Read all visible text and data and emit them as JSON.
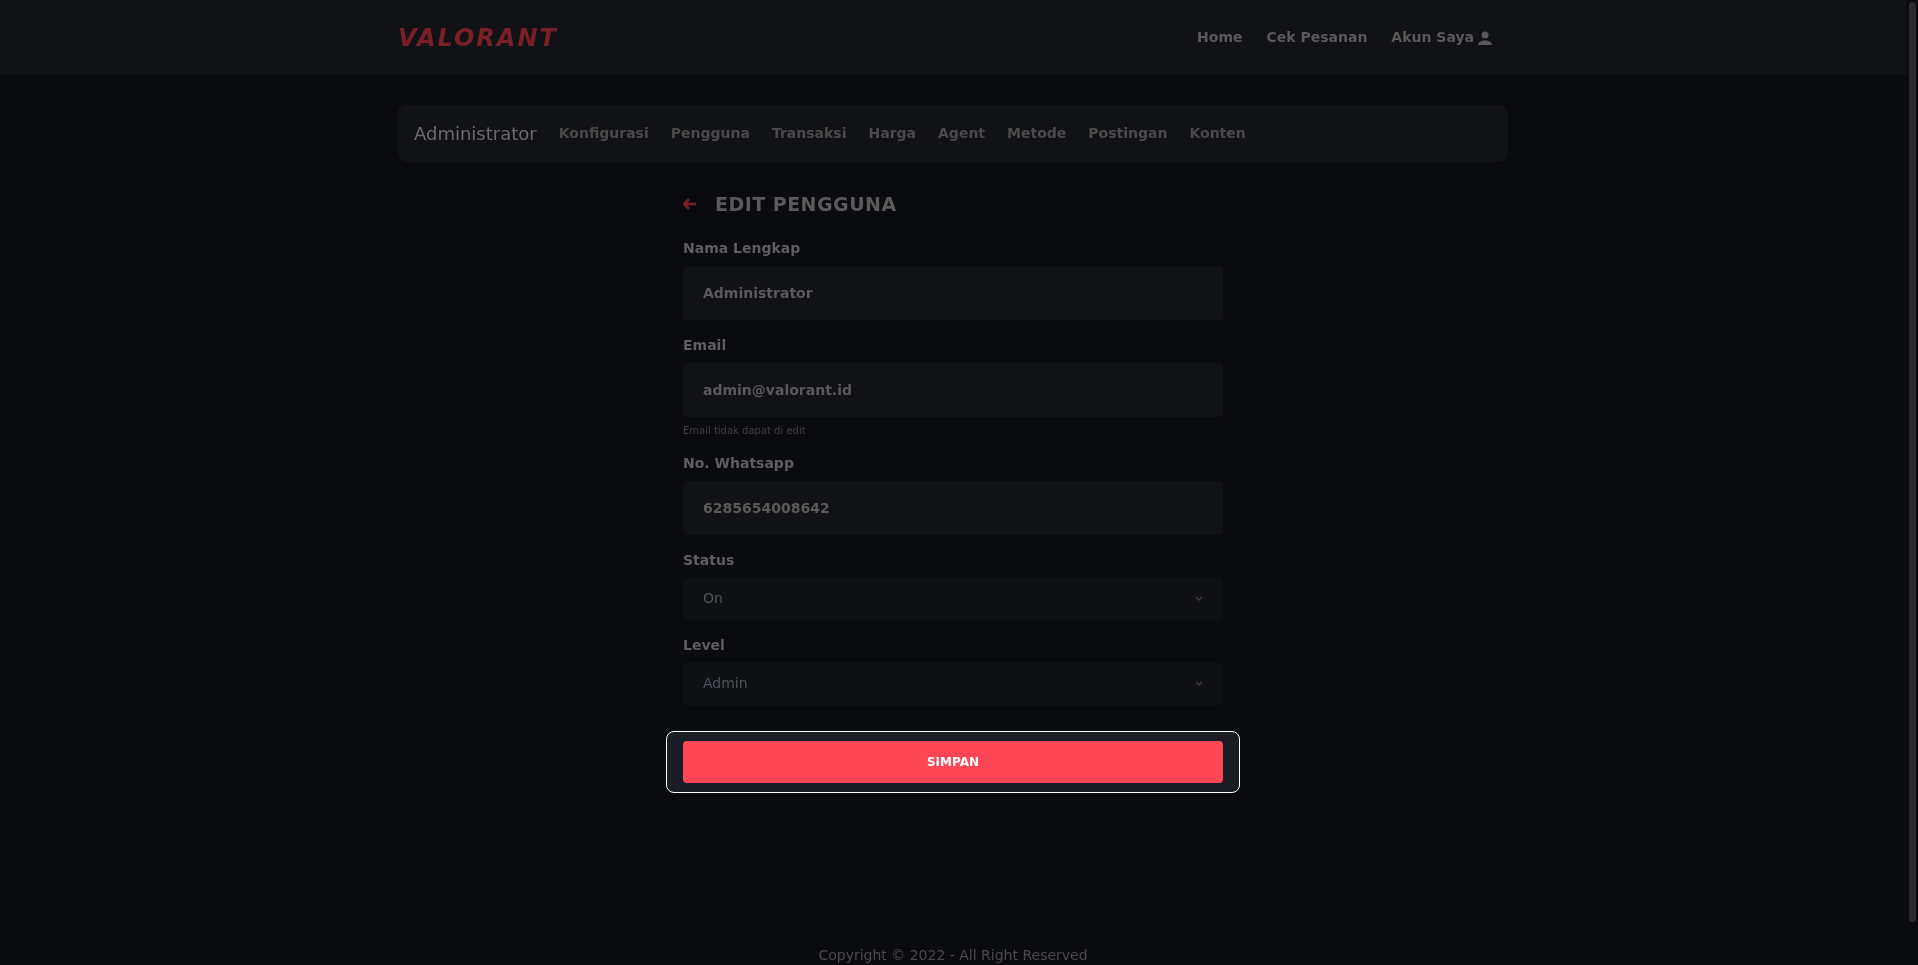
{
  "header": {
    "logo": "VALORANT",
    "nav": [
      {
        "label": "Home",
        "kind": "link"
      },
      {
        "label": "Cek Pesanan",
        "kind": "link"
      },
      {
        "label": "Akun Saya",
        "kind": "account"
      }
    ]
  },
  "admin_nav": {
    "title": "Administrator",
    "items": [
      "Konfigurasi",
      "Pengguna",
      "Transaksi",
      "Harga",
      "Agent",
      "Metode",
      "Postingan",
      "Konten"
    ]
  },
  "form": {
    "title": "EDIT PENGGUNA",
    "fields": [
      {
        "kind": "text",
        "label": "Nama Lengkap",
        "value": "Administrator"
      },
      {
        "kind": "text",
        "label": "Email",
        "value": "admin@valorant.id",
        "hint": "Email tidak dapat di edit"
      },
      {
        "kind": "text",
        "label": "No. Whatsapp",
        "value": "6285654008642"
      },
      {
        "kind": "select",
        "label": "Status",
        "value": "On"
      },
      {
        "kind": "select",
        "label": "Level",
        "value": "Admin"
      }
    ],
    "submit": "SIMPAN"
  },
  "footer": "Copyright © 2022 - All Right Reserved"
}
